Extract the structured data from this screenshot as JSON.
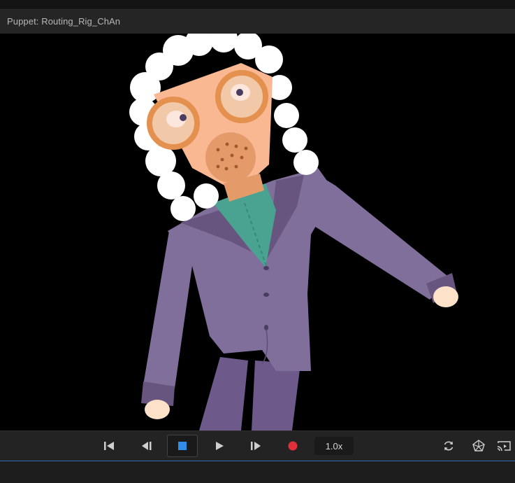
{
  "panel": {
    "title": "Puppet: Routing_Rig_ChAn"
  },
  "transport": {
    "speed_label": "1.0x",
    "buttons": [
      {
        "name": "go-to-start",
        "icon": "skip-to-start-icon"
      },
      {
        "name": "step-back",
        "icon": "step-back-icon"
      },
      {
        "name": "stop",
        "icon": "stop-icon"
      },
      {
        "name": "play",
        "icon": "play-icon"
      },
      {
        "name": "step-forward",
        "icon": "step-forward-icon"
      },
      {
        "name": "record",
        "icon": "record-icon"
      }
    ],
    "right_icons": [
      "refresh-icon",
      "mesh-icon",
      "cast-icon"
    ]
  },
  "colors": {
    "accent_blue": "#2f8ce8",
    "record_red": "#e0303a",
    "stage_bg": "#000000"
  }
}
